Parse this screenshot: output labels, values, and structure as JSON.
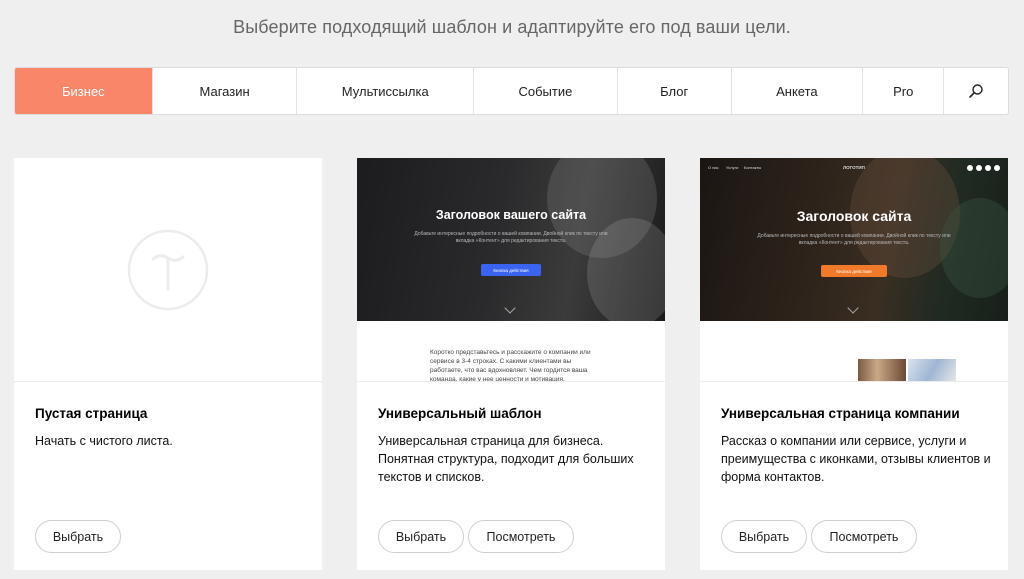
{
  "header": {
    "subtitle": "Выберите подходящий шаблон и адаптируйте его под ваши цели."
  },
  "tabs": [
    {
      "label": "Бизнес",
      "active": true
    },
    {
      "label": "Магазин",
      "active": false
    },
    {
      "label": "Мультиссылка",
      "active": false
    },
    {
      "label": "Событие",
      "active": false
    },
    {
      "label": "Блог",
      "active": false
    },
    {
      "label": "Анкета",
      "active": false
    },
    {
      "label": "Pro",
      "active": false
    }
  ],
  "search_icon": "search-icon",
  "accent_color": "#fa8669",
  "cards": [
    {
      "title": "Пустая страница",
      "description": "Начать с чистого листа.",
      "select_label": "Выбрать"
    },
    {
      "title": "Универсальный шаблон",
      "description": "Универсальная страница для бизнеса. Понятная структура, подходит для больших текстов и списков.",
      "select_label": "Выбрать",
      "view_label": "Посмотреть",
      "preview": {
        "heading": "Заголовок вашего сайта",
        "subtext": "Добавьте интересные подробности о вашей компании. Двойной клик по тексту или вкладка «Контент» для редактирования текста.",
        "button": "Кнопка действия",
        "button_color": "#3a63f0",
        "body_text": "Коротко представьтесь и расскажите о компании или сервисе в 3-4 строках. С какими клиентами вы работаете, что вас вдохновляет. Чем гордится ваша команда, какие у нее ценности и мотивация."
      }
    },
    {
      "title": "Универсальная страница компании",
      "description": "Рассказ о компании или сервисе, услуги и преимущества с иконками, отзывы клиентов и форма контактов.",
      "select_label": "Выбрать",
      "view_label": "Посмотреть",
      "preview": {
        "nav": [
          "О нас",
          "Услуги",
          "Контакты"
        ],
        "logo": "ЛОГОТИП",
        "heading": "Заголовок сайта",
        "subtext": "Добавьте интересные подробности о вашей компании. Двойной клик по тексту или вкладка «Контент» для редактирования текста.",
        "button": "Кнопка действия",
        "button_color": "#f07a2a"
      }
    }
  ]
}
